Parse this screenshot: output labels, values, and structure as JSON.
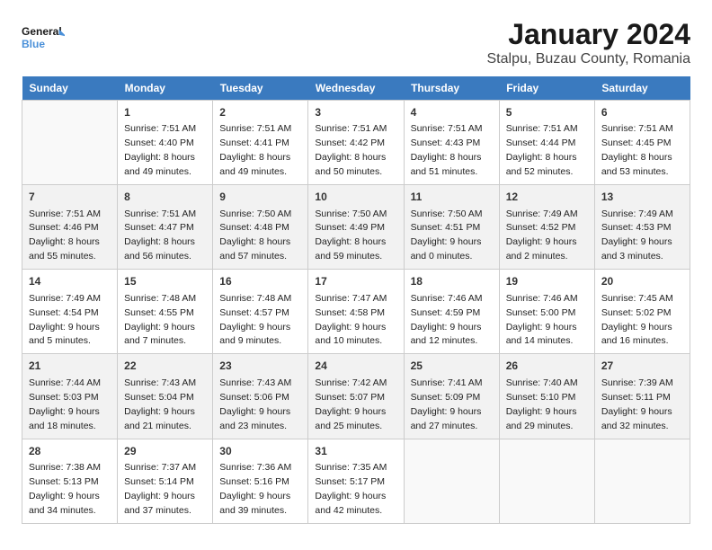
{
  "header": {
    "logo_line1": "General",
    "logo_line2": "Blue",
    "month": "January 2024",
    "location": "Stalpu, Buzau County, Romania"
  },
  "weekdays": [
    "Sunday",
    "Monday",
    "Tuesday",
    "Wednesday",
    "Thursday",
    "Friday",
    "Saturday"
  ],
  "weeks": [
    [
      {
        "day": "",
        "sunrise": "",
        "sunset": "",
        "daylight": ""
      },
      {
        "day": "1",
        "sunrise": "7:51 AM",
        "sunset": "4:40 PM",
        "daylight": "8 hours and 49 minutes."
      },
      {
        "day": "2",
        "sunrise": "7:51 AM",
        "sunset": "4:41 PM",
        "daylight": "8 hours and 49 minutes."
      },
      {
        "day": "3",
        "sunrise": "7:51 AM",
        "sunset": "4:42 PM",
        "daylight": "8 hours and 50 minutes."
      },
      {
        "day": "4",
        "sunrise": "7:51 AM",
        "sunset": "4:43 PM",
        "daylight": "8 hours and 51 minutes."
      },
      {
        "day": "5",
        "sunrise": "7:51 AM",
        "sunset": "4:44 PM",
        "daylight": "8 hours and 52 minutes."
      },
      {
        "day": "6",
        "sunrise": "7:51 AM",
        "sunset": "4:45 PM",
        "daylight": "8 hours and 53 minutes."
      }
    ],
    [
      {
        "day": "7",
        "sunrise": "7:51 AM",
        "sunset": "4:46 PM",
        "daylight": "8 hours and 55 minutes."
      },
      {
        "day": "8",
        "sunrise": "7:51 AM",
        "sunset": "4:47 PM",
        "daylight": "8 hours and 56 minutes."
      },
      {
        "day": "9",
        "sunrise": "7:50 AM",
        "sunset": "4:48 PM",
        "daylight": "8 hours and 57 minutes."
      },
      {
        "day": "10",
        "sunrise": "7:50 AM",
        "sunset": "4:49 PM",
        "daylight": "8 hours and 59 minutes."
      },
      {
        "day": "11",
        "sunrise": "7:50 AM",
        "sunset": "4:51 PM",
        "daylight": "9 hours and 0 minutes."
      },
      {
        "day": "12",
        "sunrise": "7:49 AM",
        "sunset": "4:52 PM",
        "daylight": "9 hours and 2 minutes."
      },
      {
        "day": "13",
        "sunrise": "7:49 AM",
        "sunset": "4:53 PM",
        "daylight": "9 hours and 3 minutes."
      }
    ],
    [
      {
        "day": "14",
        "sunrise": "7:49 AM",
        "sunset": "4:54 PM",
        "daylight": "9 hours and 5 minutes."
      },
      {
        "day": "15",
        "sunrise": "7:48 AM",
        "sunset": "4:55 PM",
        "daylight": "9 hours and 7 minutes."
      },
      {
        "day": "16",
        "sunrise": "7:48 AM",
        "sunset": "4:57 PM",
        "daylight": "9 hours and 9 minutes."
      },
      {
        "day": "17",
        "sunrise": "7:47 AM",
        "sunset": "4:58 PM",
        "daylight": "9 hours and 10 minutes."
      },
      {
        "day": "18",
        "sunrise": "7:46 AM",
        "sunset": "4:59 PM",
        "daylight": "9 hours and 12 minutes."
      },
      {
        "day": "19",
        "sunrise": "7:46 AM",
        "sunset": "5:00 PM",
        "daylight": "9 hours and 14 minutes."
      },
      {
        "day": "20",
        "sunrise": "7:45 AM",
        "sunset": "5:02 PM",
        "daylight": "9 hours and 16 minutes."
      }
    ],
    [
      {
        "day": "21",
        "sunrise": "7:44 AM",
        "sunset": "5:03 PM",
        "daylight": "9 hours and 18 minutes."
      },
      {
        "day": "22",
        "sunrise": "7:43 AM",
        "sunset": "5:04 PM",
        "daylight": "9 hours and 21 minutes."
      },
      {
        "day": "23",
        "sunrise": "7:43 AM",
        "sunset": "5:06 PM",
        "daylight": "9 hours and 23 minutes."
      },
      {
        "day": "24",
        "sunrise": "7:42 AM",
        "sunset": "5:07 PM",
        "daylight": "9 hours and 25 minutes."
      },
      {
        "day": "25",
        "sunrise": "7:41 AM",
        "sunset": "5:09 PM",
        "daylight": "9 hours and 27 minutes."
      },
      {
        "day": "26",
        "sunrise": "7:40 AM",
        "sunset": "5:10 PM",
        "daylight": "9 hours and 29 minutes."
      },
      {
        "day": "27",
        "sunrise": "7:39 AM",
        "sunset": "5:11 PM",
        "daylight": "9 hours and 32 minutes."
      }
    ],
    [
      {
        "day": "28",
        "sunrise": "7:38 AM",
        "sunset": "5:13 PM",
        "daylight": "9 hours and 34 minutes."
      },
      {
        "day": "29",
        "sunrise": "7:37 AM",
        "sunset": "5:14 PM",
        "daylight": "9 hours and 37 minutes."
      },
      {
        "day": "30",
        "sunrise": "7:36 AM",
        "sunset": "5:16 PM",
        "daylight": "9 hours and 39 minutes."
      },
      {
        "day": "31",
        "sunrise": "7:35 AM",
        "sunset": "5:17 PM",
        "daylight": "9 hours and 42 minutes."
      },
      {
        "day": "",
        "sunrise": "",
        "sunset": "",
        "daylight": ""
      },
      {
        "day": "",
        "sunrise": "",
        "sunset": "",
        "daylight": ""
      },
      {
        "day": "",
        "sunrise": "",
        "sunset": "",
        "daylight": ""
      }
    ]
  ]
}
